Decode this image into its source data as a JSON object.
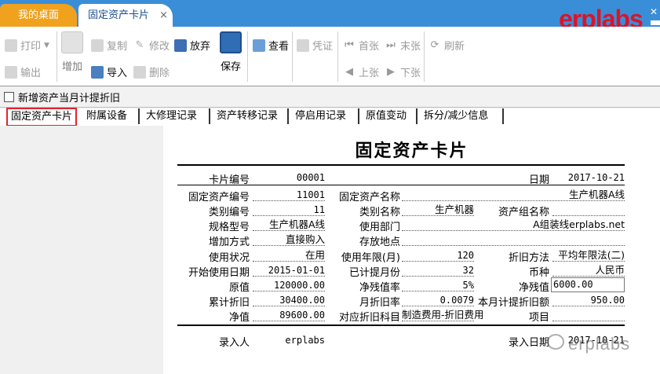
{
  "tabs": {
    "home": "我的桌面",
    "card": "固定资产卡片",
    "close": "×"
  },
  "brand": "erplabs",
  "toolbar": {
    "print": "打印",
    "export": "输出",
    "add": "增加",
    "copy": "复制",
    "import": "导入",
    "modify": "修改",
    "delete": "删除",
    "discard": "放弃",
    "save": "保存",
    "view": "查看",
    "voucher": "凭证",
    "first": "首张",
    "prev": "上张",
    "last": "末张",
    "next": "下张",
    "refresh": "刷新"
  },
  "option": {
    "label": "新增资产当月计提折旧"
  },
  "subtabs": [
    "固定资产卡片",
    "附属设备",
    "大修理记录",
    "资产转移记录",
    "停启用记录",
    "原值变动",
    "拆分/减少信息"
  ],
  "card": {
    "title": "固定资产卡片",
    "card_no_label": "卡片编号",
    "card_no": "00001",
    "date_label": "日期",
    "date": "2017-10-21",
    "asset_no_label": "固定资产编号",
    "asset_no": "11001",
    "asset_name_label": "固定资产名称",
    "asset_name": "生产机器A线",
    "cat_no_label": "类别编号",
    "cat_no": "11",
    "cat_name_label": "类别名称",
    "cat_name": "生产机器",
    "group_label": "资产组名称",
    "group": "",
    "spec_label": "规格型号",
    "spec": "生产机器A线",
    "dept_label": "使用部门",
    "dept": "A组装线erplabs.net",
    "add_method_label": "增加方式",
    "add_method": "直接购入",
    "location_label": "存放地点",
    "location": "",
    "status_label": "使用状况",
    "status": "在用",
    "life_label": "使用年限(月)",
    "life": "120",
    "dep_method_label": "折旧方法",
    "dep_method": "平均年限法(二)",
    "start_label": "开始使用日期",
    "start": "2015-01-01",
    "months_label": "已计提月份",
    "months": "32",
    "currency_label": "币种",
    "currency": "人民币",
    "orig_label": "原值",
    "orig": "120000.00",
    "residual_rate_label": "净残值率",
    "residual_rate": "5%",
    "residual_label": "净残值",
    "residual": "6000.00",
    "accum_label": "累计折旧",
    "accum": "30400.00",
    "monthly_rate_label": "月折旧率",
    "monthly_rate": "0.0079",
    "month_dep_label": "本月计提折旧额",
    "month_dep": "950.00",
    "net_label": "净值",
    "net": "89600.00",
    "account_label": "对应折旧科目",
    "account": "制造费用-折旧费用",
    "project_label": "项目",
    "project": "",
    "entered_by_label": "录入人",
    "entered_by": "erplabs",
    "entry_date_label": "录入日期",
    "entry_date": "2017-10-21"
  },
  "watermark": "erplabs",
  "colors": {
    "tabbar": "#3a8ed8",
    "home_tab": "#f0a21e",
    "brand": "#d8152a",
    "highlight": "#e0252b"
  }
}
